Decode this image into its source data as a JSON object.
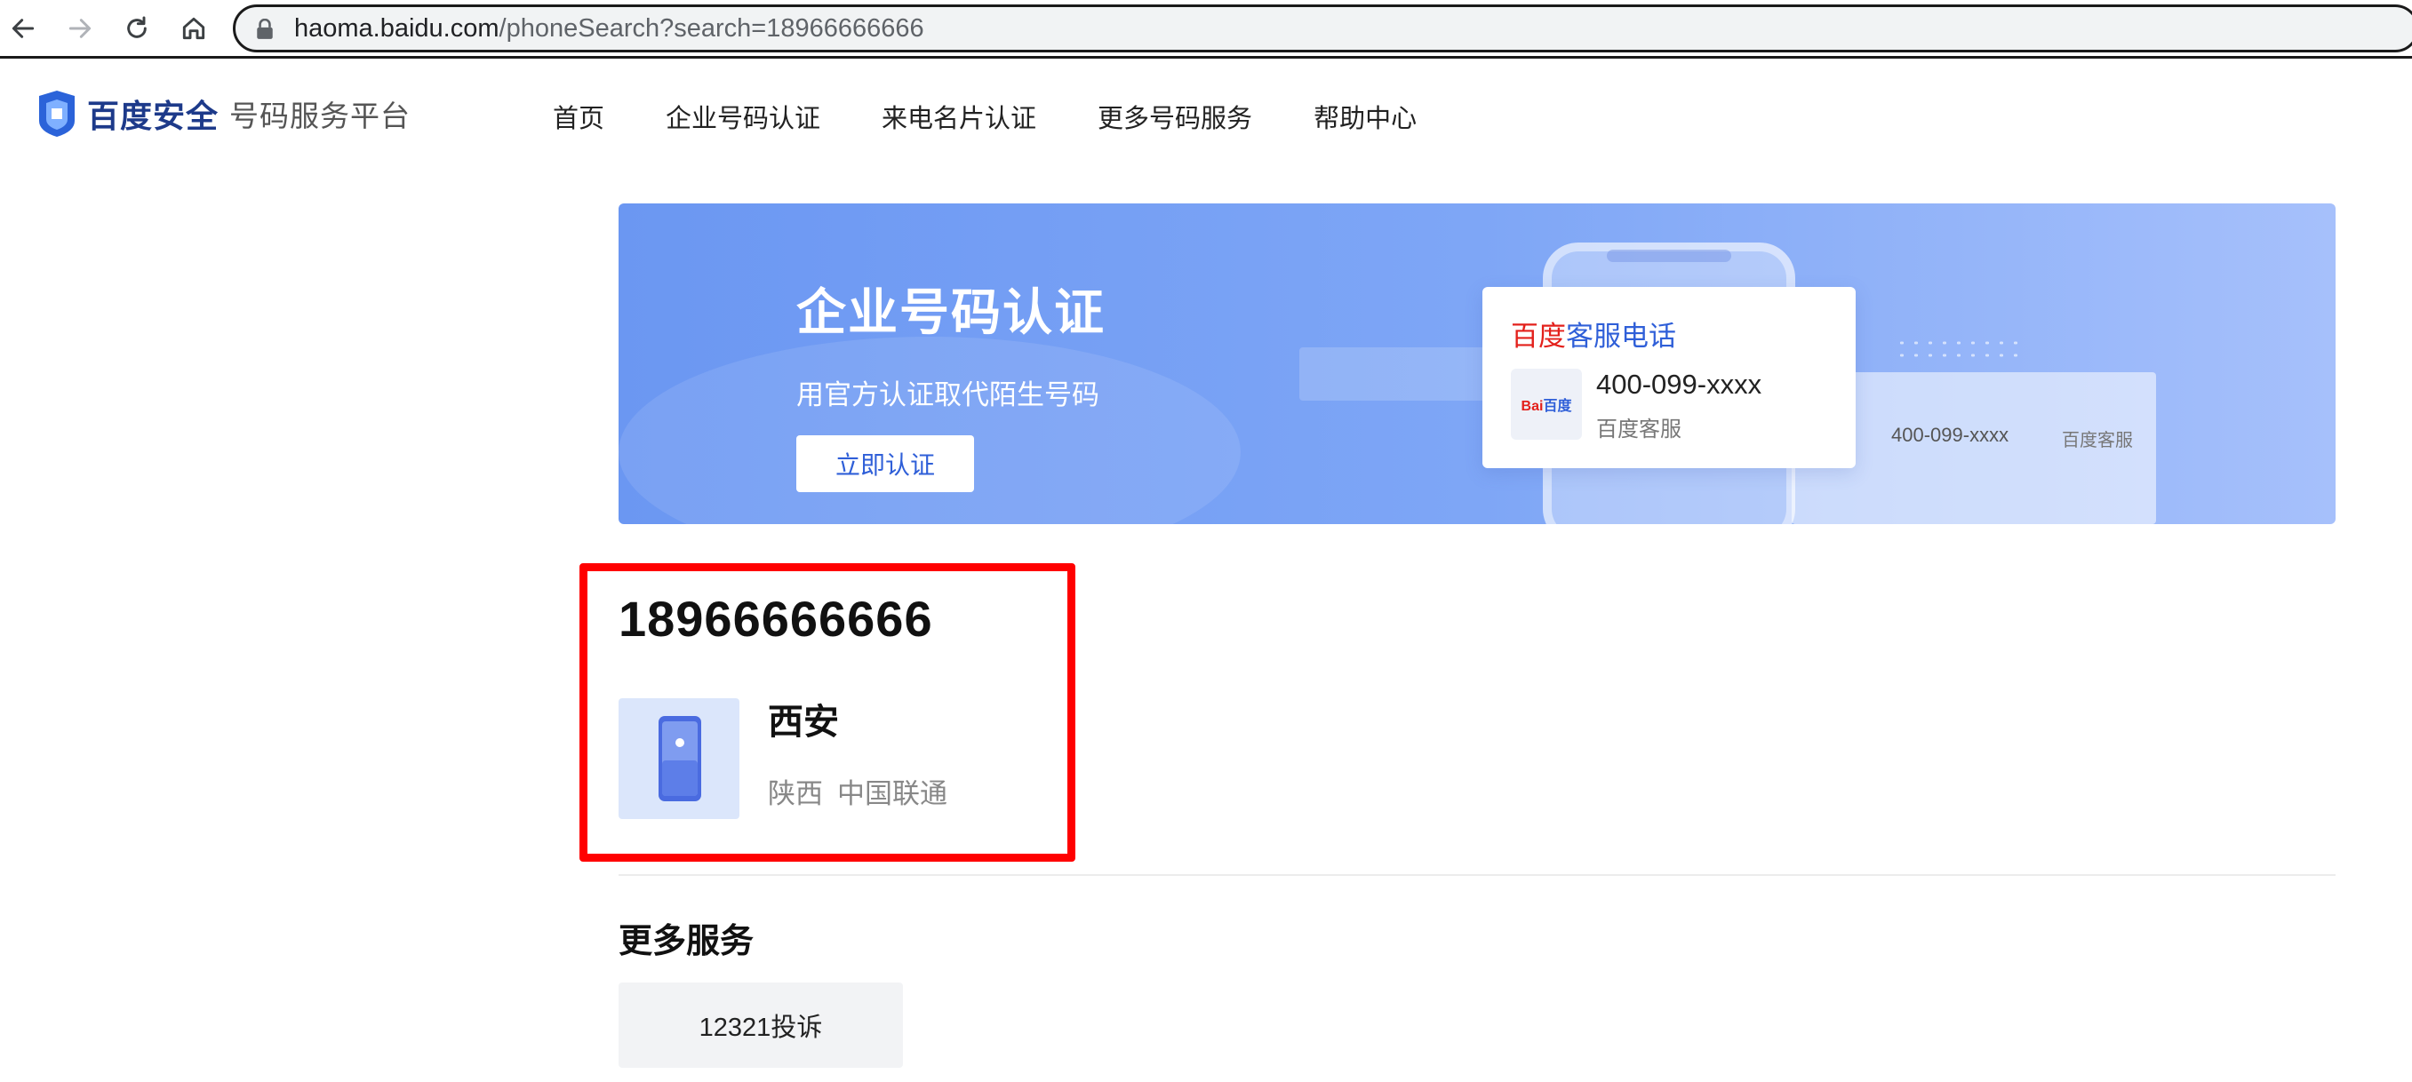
{
  "browser": {
    "url_host": "haoma.baidu.com",
    "url_path": "/phoneSearch?search=18966666666",
    "icons": [
      "back-icon",
      "forward-icon",
      "reload-icon",
      "home-icon",
      "lock-icon"
    ]
  },
  "header": {
    "logo_brand": "百度安全",
    "logo_sub": "号码服务平台",
    "nav": [
      "首页",
      "企业号码认证",
      "来电名片认证",
      "更多号码服务",
      "帮助中心"
    ]
  },
  "banner": {
    "title": "企业号码认证",
    "subtitle": "用官方认证取代陌生号码",
    "button": "立即认证",
    "card": {
      "title_red": "百度",
      "title_blue": "客服电话",
      "logo_text_red": "Bai",
      "logo_text_blue": "百度",
      "number": "400-099-xxxx",
      "name": "百度客服"
    },
    "panel_number": "400-099-xxxx",
    "panel_name": "百度客服"
  },
  "result": {
    "number": "18966666666",
    "city": "西安",
    "province": "陕西",
    "carrier": "中国联通"
  },
  "more": {
    "title": "更多服务",
    "items": [
      "12321投诉"
    ]
  },
  "colors": {
    "accent": "#2f5fd8",
    "brand_red": "#e3201b",
    "highlight": "#ff0000",
    "banner_start": "#6b97f2",
    "banner_end": "#a6c0fb"
  }
}
